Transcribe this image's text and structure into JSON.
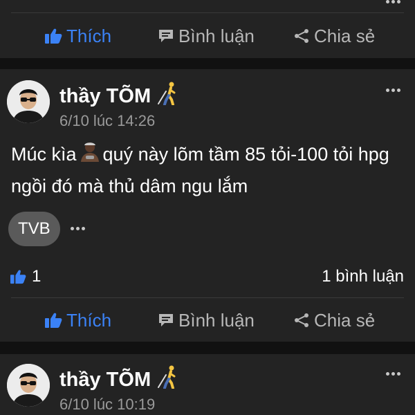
{
  "actions": {
    "like": "Thích",
    "comment": "Bình luận",
    "share": "Chia sẻ"
  },
  "post1": {
    "author": "thầy TÕM",
    "time": "6/10 lúc 14:26",
    "text_part1": "Múc kìa",
    "text_part2": "quý này lõm tầm 85 tỏi-100 tỏi hpg ngồi đó mà thủ dâm ngu lắm",
    "tag": "TVB",
    "like_count": "1",
    "comment_count": "1 bình luận"
  },
  "post2": {
    "author": "thầy TÕM",
    "time": "6/10 lúc 10:19"
  },
  "colors": {
    "accent": "#3b82f6",
    "card": "#232323",
    "background": "#111111"
  },
  "icons": [
    "like-icon",
    "comment-icon",
    "share-icon",
    "more-icon",
    "person-walking-icon",
    "emoji-man-icon"
  ]
}
